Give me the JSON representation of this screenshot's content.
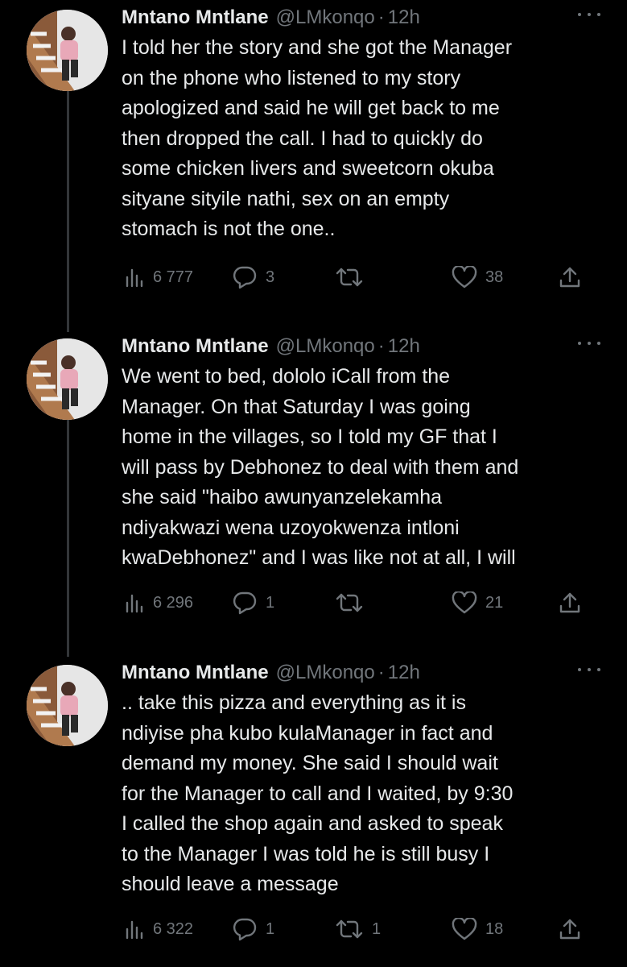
{
  "tweets": [
    {
      "name": "Mntano Mntlane",
      "handle": "@LMkonqo",
      "separator": "·",
      "time": "12h",
      "text": "I told her the story and she got the Manager\non the phone who listened to my story\napologized and said he will get back to me\nthen dropped the call. I had to quickly do\nsome chicken livers and sweetcorn okuba\nsityane sityile nathi, sex on an empty\nstomach is not the one..",
      "views": "6 777",
      "replies": "3",
      "retweets": "",
      "likes": "38"
    },
    {
      "name": "Mntano Mntlane",
      "handle": "@LMkonqo",
      "separator": "·",
      "time": "12h",
      "text": "We went to bed, dololo iCall from the\nManager. On that Saturday I was going\nhome in the villages, so I told my GF that I\nwill pass by Debhonez to deal with them and\nshe said \"haibo awunyanzelekamha\nndiyakwazi wena uzoyokwenza intloni\nkwaDebhonez\" and I was like not at all, I will",
      "views": "6 296",
      "replies": "1",
      "retweets": "",
      "likes": "21"
    },
    {
      "name": "Mntano Mntlane",
      "handle": "@LMkonqo",
      "separator": "·",
      "time": "12h",
      "text": ".. take this pizza and everything as it is\nndiyise pha kubo kulaManager in fact and\ndemand my money. She said I should wait\nfor the Manager to call and I waited, by 9:30\nI called the shop again and asked to speak\nto the Manager I was told he is still busy I\nshould leave a message",
      "views": "6 322",
      "replies": "1",
      "retweets": "1",
      "likes": "18"
    }
  ],
  "icons": {
    "views": "bar-chart-icon",
    "reply": "speech-bubble-icon",
    "retweet": "retweet-arrows-icon",
    "like": "heart-outline-icon",
    "share": "upload-arrow-icon",
    "more": "ellipsis-icon"
  },
  "colors": {
    "background": "#000000",
    "text": "#e7e9ea",
    "muted": "#71767b",
    "thread_line": "#333639"
  }
}
